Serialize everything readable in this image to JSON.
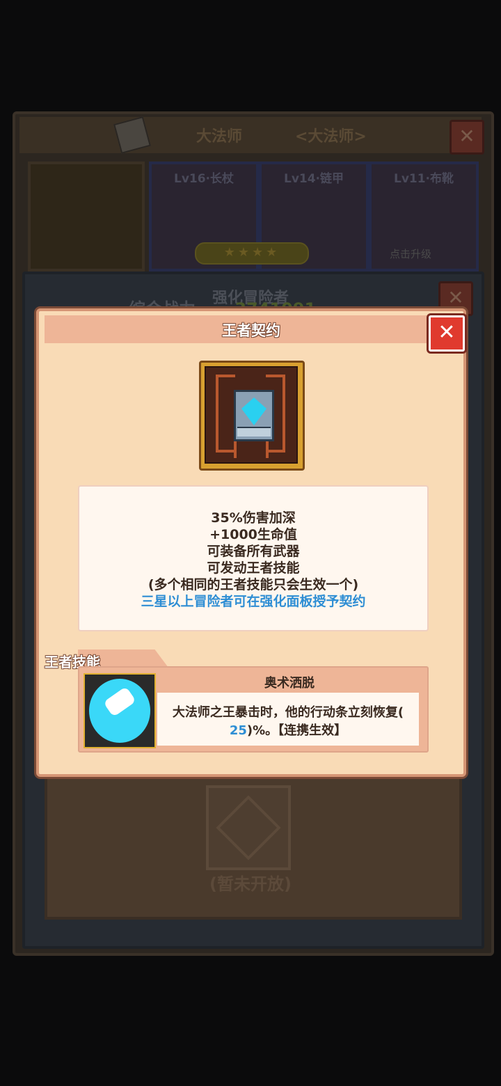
{
  "background": {
    "header_title": "大法师",
    "header_subtitle": "<大法师>",
    "slots": [
      {
        "label": "Lv16·长杖"
      },
      {
        "label": "Lv14·链甲"
      },
      {
        "label": "Lv11·布靴"
      }
    ],
    "stars": "★★★★",
    "upgrade_label": "点击升级",
    "panel_title": "强化冒险者",
    "power_label": "综合战力",
    "power_value": "3741091",
    "locked_text": "(暂未开放)"
  },
  "dialog": {
    "title": "王者契约",
    "close_label": "✕",
    "description": [
      "35%伤害加深",
      "+1000生命值",
      "可装备所有武器",
      "可发动王者技能",
      "(多个相同的王者技能只会生效一个)"
    ],
    "note": "三星以上冒险者可在强化面板授予契约",
    "skill_section_label": "王者技能",
    "skill": {
      "name": "奥术洒脱",
      "desc_part1": "大法师之王暴击时，他的行动条立刻恢复(",
      "desc_value": "25",
      "desc_part2": ")%。【连携生效】"
    }
  },
  "colors": {
    "dialog_bg": "#f9dbb6",
    "header_bg": "#eeb597",
    "close_red": "#e03a2e",
    "note_blue": "#2e8ed4",
    "text_dark": "#3a2a20"
  }
}
